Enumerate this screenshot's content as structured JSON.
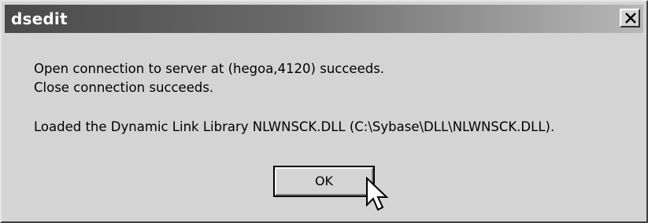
{
  "window": {
    "title": "dsedit",
    "close_glyph": "✕"
  },
  "message": {
    "line1": "Open connection to server at (hegoa,4120) succeeds.",
    "line2": "Close connection succeeds.",
    "line3": "Loaded the Dynamic Link Library NLWNSCK.DLL (C:\\Sybase\\DLL\\NLWNSCK.DLL)."
  },
  "buttons": {
    "ok_label": "OK"
  },
  "icons": {
    "close": "close-icon",
    "cursor": "mouse-pointer-icon"
  },
  "colors": {
    "face": "#d4d4d4",
    "title_start": "#4a4a4a",
    "title_end": "#b8b8b8",
    "title_text": "#ffffff"
  }
}
